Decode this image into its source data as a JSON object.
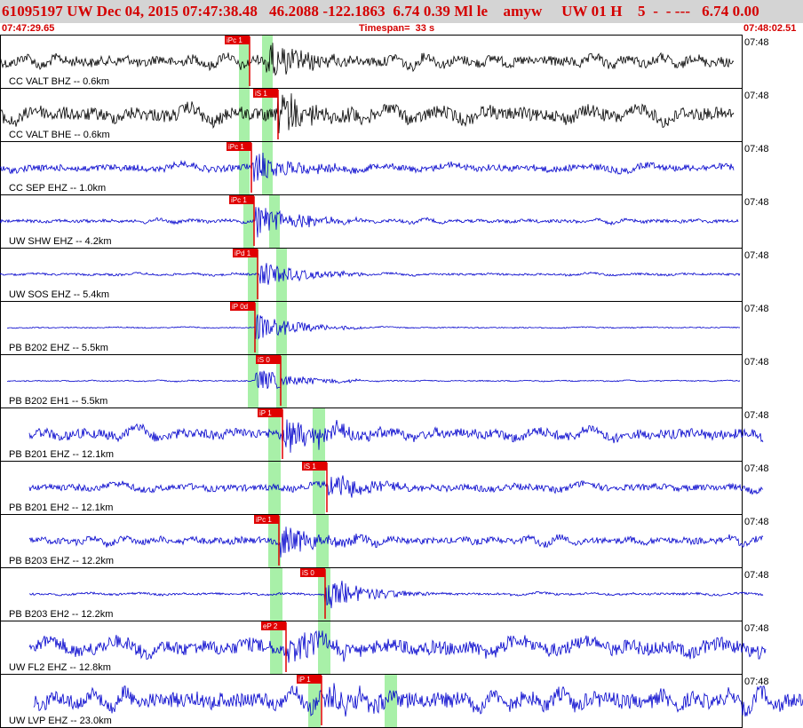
{
  "header": {
    "title": "61095197 UW Dec 04, 2015 07:47:38.48   46.2088 -122.1863  6.74 0.39 Ml le    amyw     UW 01 H    5  -  - ---   6.74 0.00",
    "start_time": "07:47:29.65",
    "timespan_label": "Timespan=  33 s",
    "end_time": "07:48:02.51"
  },
  "colors": {
    "header_text": "#d40000",
    "title_bg": "#d4d4d4",
    "trace_dark": "#000000",
    "trace_blue": "#0000cc",
    "pick_marker": "#e00000",
    "highlight": "#a8f0a8"
  },
  "panels": [
    {
      "channel_label": "CC VALT BHZ -- 0.6km",
      "time_label": "07:48",
      "pick_label": "iPc 1",
      "trace_color": "dark"
    },
    {
      "channel_label": "CC VALT BHE -- 0.6km",
      "time_label": "07:48",
      "pick_label": "iS 1",
      "trace_color": "dark"
    },
    {
      "channel_label": "CC SEP EHZ -- 1.0km",
      "time_label": "07:48",
      "pick_label": "iPc 1",
      "trace_color": "blue"
    },
    {
      "channel_label": "UW SHW EHZ -- 4.2km",
      "time_label": "07:48",
      "pick_label": "iPc 1",
      "trace_color": "blue"
    },
    {
      "channel_label": "UW SOS EHZ -- 5.4km",
      "time_label": "07:48",
      "pick_label": "iPd 1",
      "trace_color": "blue"
    },
    {
      "channel_label": "PB B202 EHZ -- 5.5km",
      "time_label": "07:48",
      "pick_label": "iP 0d",
      "trace_color": "blue"
    },
    {
      "channel_label": "PB B202 EH1 -- 5.5km",
      "time_label": "07:48",
      "pick_label": "iS 0",
      "trace_color": "blue"
    },
    {
      "channel_label": "PB B201 EHZ -- 12.1km",
      "time_label": "07:48",
      "pick_label": "iP 1",
      "trace_color": "blue"
    },
    {
      "channel_label": "PB B201 EH2 -- 12.1km",
      "time_label": "07:48",
      "pick_label": "iS 1",
      "trace_color": "blue"
    },
    {
      "channel_label": "PB B203 EHZ -- 12.2km",
      "time_label": "07:48",
      "pick_label": "iPc 1",
      "trace_color": "blue"
    },
    {
      "channel_label": "PB B203 EH2 -- 12.2km",
      "time_label": "07:48",
      "pick_label": "iS 0",
      "trace_color": "blue"
    },
    {
      "channel_label": "UW FL2 EHZ -- 12.8km",
      "time_label": "07:48",
      "pick_label": "eP 2",
      "trace_color": "blue"
    },
    {
      "channel_label": "UW LVP EHZ -- 23.0km",
      "time_label": "07:48",
      "pick_label": "iP 1",
      "trace_color": "blue"
    }
  ]
}
